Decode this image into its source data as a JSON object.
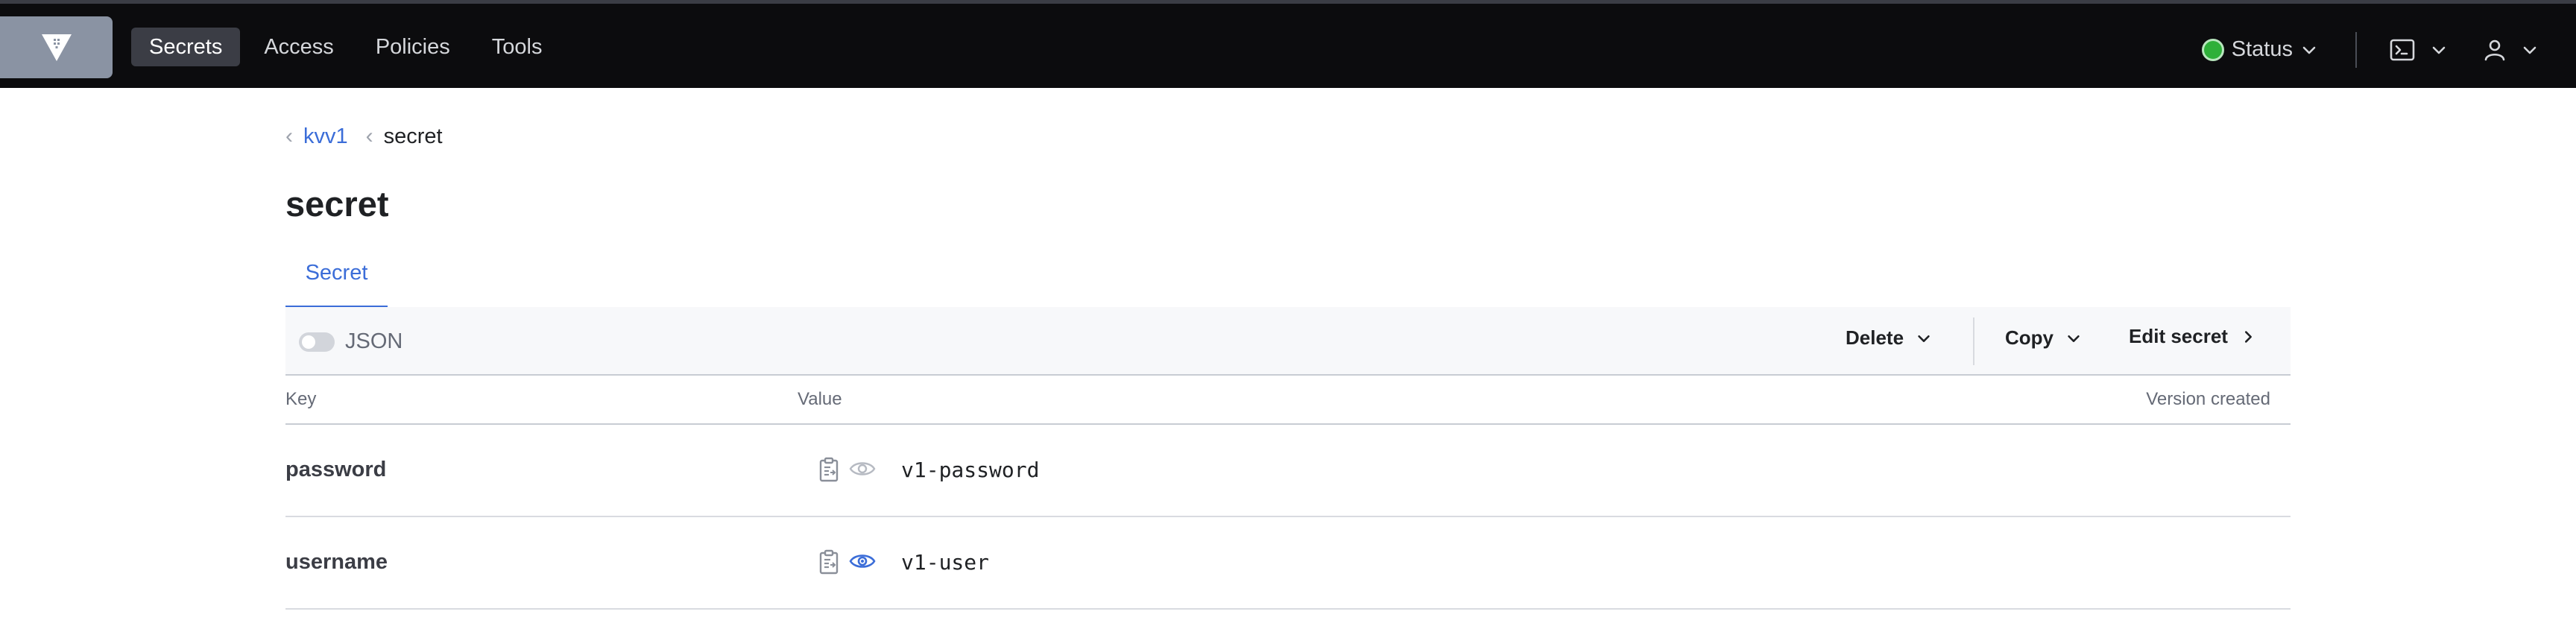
{
  "nav": {
    "items": [
      {
        "label": "Secrets",
        "active": true
      },
      {
        "label": "Access",
        "active": false
      },
      {
        "label": "Policies",
        "active": false
      },
      {
        "label": "Tools",
        "active": false
      }
    ],
    "status_label": "Status",
    "status_color": "#2eb039"
  },
  "breadcrumb": {
    "parent": "kvv1",
    "current": "secret"
  },
  "page": {
    "title": "secret",
    "tab": "Secret"
  },
  "toolbar": {
    "json_label": "JSON",
    "json_enabled": false,
    "delete_label": "Delete",
    "copy_label": "Copy",
    "edit_label": "Edit secret"
  },
  "table": {
    "headers": {
      "key": "Key",
      "value": "Value",
      "version": "Version created"
    },
    "rows": [
      {
        "key": "password",
        "value": "v1-password",
        "value_visible": false
      },
      {
        "key": "username",
        "value": "v1-user",
        "value_visible": true
      }
    ]
  },
  "icons": {
    "logo": "vault-logo-icon",
    "console": "terminal-icon",
    "user": "user-icon",
    "copy": "clipboard-icon",
    "reveal": "eye-icon"
  },
  "colors": {
    "accent": "#3b6dd8",
    "nav_bg": "#0c0c0e"
  }
}
